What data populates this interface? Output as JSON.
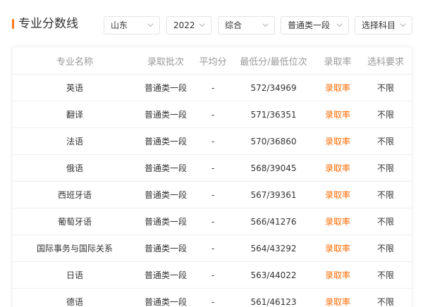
{
  "header": {
    "title": "专业分数线",
    "filters": [
      {
        "value": "山东"
      },
      {
        "value": "2022"
      },
      {
        "value": "综合"
      },
      {
        "value": "普通类一段"
      },
      {
        "value": "选择科目"
      }
    ]
  },
  "table": {
    "columns": [
      "专业名称",
      "录取批次",
      "平均分",
      "最低分/最低位次",
      "录取率",
      "选科要求"
    ],
    "rows": [
      {
        "major": "英语",
        "batch": "普通类一段",
        "avg": "-",
        "min": "572/34969",
        "rate": "录取率",
        "req": "不限"
      },
      {
        "major": "翻译",
        "batch": "普通类一段",
        "avg": "-",
        "min": "571/36351",
        "rate": "录取率",
        "req": "不限"
      },
      {
        "major": "法语",
        "batch": "普通类一段",
        "avg": "-",
        "min": "570/36860",
        "rate": "录取率",
        "req": "不限"
      },
      {
        "major": "俄语",
        "batch": "普通类一段",
        "avg": "-",
        "min": "568/39045",
        "rate": "录取率",
        "req": "不限"
      },
      {
        "major": "西班牙语",
        "batch": "普通类一段",
        "avg": "-",
        "min": "567/39361",
        "rate": "录取率",
        "req": "不限"
      },
      {
        "major": "葡萄牙语",
        "batch": "普通类一段",
        "avg": "-",
        "min": "566/41276",
        "rate": "录取率",
        "req": "不限"
      },
      {
        "major": "国际事务与国际关系",
        "batch": "普通类一段",
        "avg": "-",
        "min": "564/43292",
        "rate": "录取率",
        "req": "不限"
      },
      {
        "major": "日语",
        "batch": "普通类一段",
        "avg": "-",
        "min": "563/44022",
        "rate": "录取率",
        "req": "不限"
      },
      {
        "major": "德语",
        "batch": "普通类一段",
        "avg": "-",
        "min": "561/46123",
        "rate": "录取率",
        "req": "不限"
      }
    ]
  },
  "colors": {
    "accent": "#ff6a00",
    "header_text": "#999999",
    "body_text": "#333333",
    "divider": "#f0f0f0"
  }
}
